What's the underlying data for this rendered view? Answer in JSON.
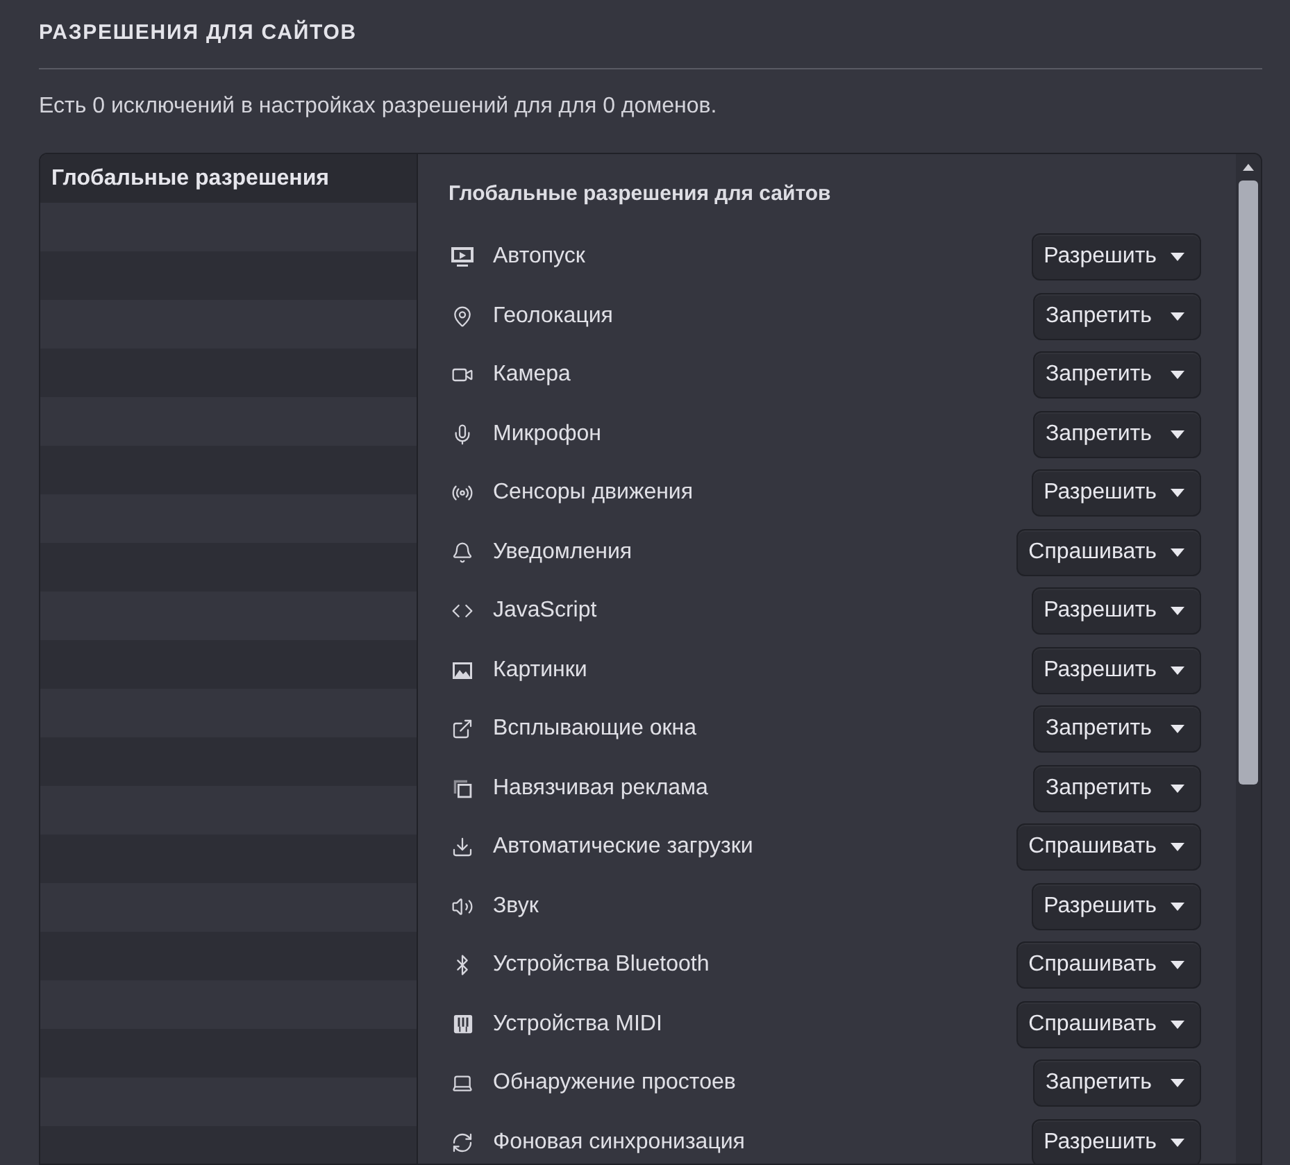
{
  "section": {
    "title": "РАЗРЕШЕНИЯ ДЛЯ САЙТОВ",
    "description": "Есть 0 исключений в настройках разрешений для для 0 доменов."
  },
  "sidebar": {
    "items": [
      {
        "label": "Глобальные разрешения",
        "selected": true
      }
    ]
  },
  "permissions": {
    "title": "Глобальные разрешения для сайтов",
    "items": [
      {
        "label": "Автопуск",
        "value": "Разрешить"
      },
      {
        "label": "Геолокация",
        "value": "Запретить"
      },
      {
        "label": "Камера",
        "value": "Запретить"
      },
      {
        "label": "Микрофон",
        "value": "Запретить"
      },
      {
        "label": "Сенсоры движения",
        "value": "Разрешить"
      },
      {
        "label": "Уведомления",
        "value": "Спрашивать"
      },
      {
        "label": "JavaScript",
        "value": "Разрешить"
      },
      {
        "label": "Картинки",
        "value": "Разрешить"
      },
      {
        "label": "Всплывающие окна",
        "value": "Запретить"
      },
      {
        "label": "Навязчивая реклама",
        "value": "Запретить"
      },
      {
        "label": "Автоматические загрузки",
        "value": "Спрашивать"
      },
      {
        "label": "Звук",
        "value": "Разрешить"
      },
      {
        "label": "Устройства Bluetooth",
        "value": "Спрашивать"
      },
      {
        "label": "Устройства MIDI",
        "value": "Спрашивать"
      },
      {
        "label": "Обнаружение простоев",
        "value": "Запретить"
      },
      {
        "label": "Фоновая синхронизация",
        "value": "Разрешить"
      }
    ]
  }
}
